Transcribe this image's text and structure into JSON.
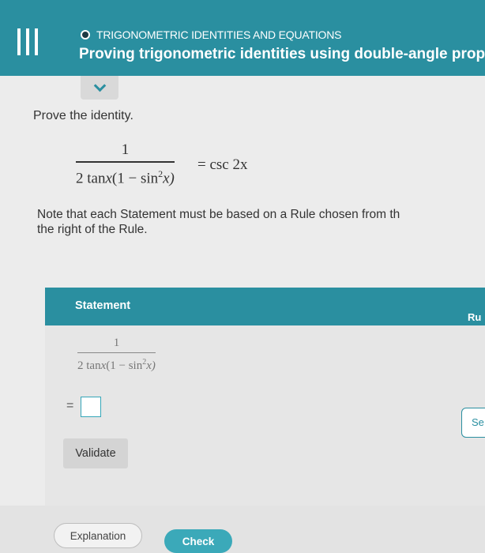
{
  "header": {
    "topic": "TRIGONOMETRIC IDENTITIES AND EQUATIONS",
    "title": "Proving trigonometric identities using double-angle proper"
  },
  "problem": {
    "prompt": "Prove the identity.",
    "identity": {
      "numerator": "1",
      "den_pre": "2 tan",
      "den_var": "x",
      "den_paren_open": "(1 − sin",
      "den_exp": "2",
      "den_paren_close": "x)",
      "rhs": "= csc 2x"
    },
    "note_line1": "Note that each Statement must be based on a Rule chosen from th",
    "note_line2": "the right of the Rule."
  },
  "table": {
    "statement_header": "Statement",
    "rule_header": "Ru",
    "first_statement": {
      "numerator": "1",
      "den_pre": "2 tan",
      "den_var": "x",
      "den_paren_open": "(1 − sin",
      "den_exp": "2",
      "den_paren_close": "x)"
    },
    "equals": "=",
    "select_rule_label": "Se",
    "validate_label": "Validate"
  },
  "footer": {
    "explanation_label": "Explanation",
    "check_label": "Check"
  },
  "colors": {
    "accent": "#2a8fa0",
    "check_button": "#3ba9b9"
  }
}
